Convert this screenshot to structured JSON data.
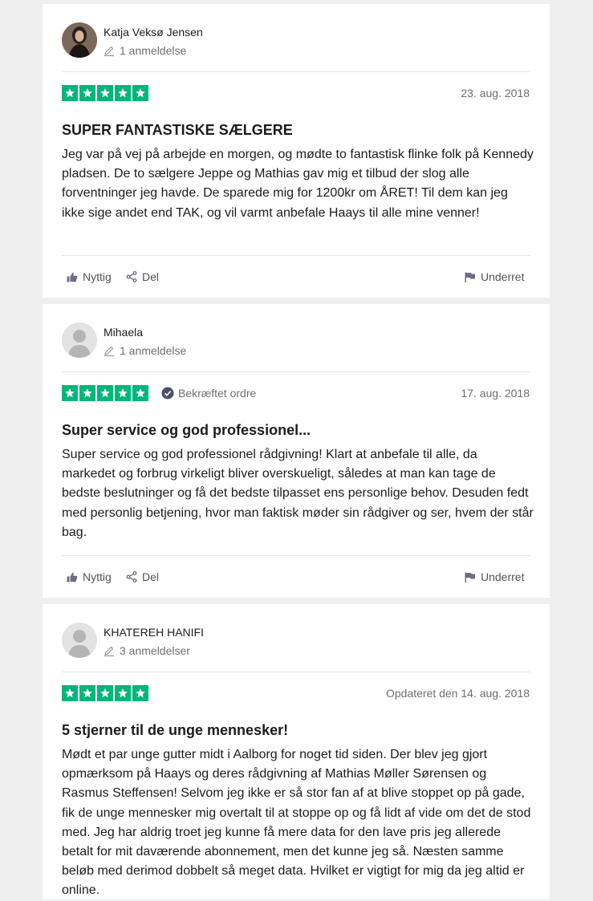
{
  "colors": {
    "star_green": "#00b67a",
    "page_bg": "#efefef",
    "muted": "#6f6f6f"
  },
  "actions": {
    "helpful": "Nyttig",
    "share": "Del",
    "report": "Underret"
  },
  "reviews": [
    {
      "reviewer": "Katja Veksø Jensen",
      "review_count": "1 anmeldelse",
      "avatar": "photo",
      "rating": 5,
      "verified": "",
      "date": "23. aug. 2018",
      "title": "SUPER FANTASTISKE SÆLGERE",
      "body": "Jeg var på vej på arbejde en morgen, og mødte to fantastisk flinke folk på Kennedy pladsen. De to sælgere Jeppe og Mathias gav mig et tilbud der slog alle forventninger jeg havde. De sparede mig for 1200kr om ÅRET! Til dem kan jeg ikke sige andet end TAK, og vil varmt anbefale Haays til alle mine venner!"
    },
    {
      "reviewer": "Mihaela",
      "review_count": "1 anmeldelse",
      "avatar": "default",
      "rating": 5,
      "verified": "Bekræftet ordre",
      "date": "17. aug. 2018",
      "title": "Super service og god professionel...",
      "body": "Super service og god professionel rådgivning! Klart at anbefale til alle, da markedet og forbrug virkeligt bliver overskueligt, således at man kan tage de bedste beslutninger og få det bedste tilpasset ens personlige behov. Desuden fedt med personlig betjening, hvor man faktisk møder sin rådgiver og ser, hvem der står bag."
    },
    {
      "reviewer": "KHATEREH HANIFI",
      "review_count": "3 anmeldelser",
      "avatar": "default",
      "rating": 5,
      "verified": "",
      "date": "Opdateret den 14. aug. 2018",
      "title": "5 stjerner til de unge mennesker!",
      "body": "Mødt et par unge gutter midt i Aalborg for noget tid siden. Der blev jeg gjort opmærksom på Haays og deres rådgivning af Mathias Møller Sørensen og Rasmus Steffensen! Selvom jeg ikke er så stor fan af at blive stoppet op på gade, fik de unge mennesker mig overtalt til at stoppe op og få lidt af vide om det de stod med. Jeg har aldrig troet jeg kunne få mere data for den lave pris jeg allerede betalt for mit daværende abonnement, men det kunne jeg så. Næsten samme beløb med derimod dobbelt så meget data. Hvilket er vigtigt for mig da jeg altid er online."
    }
  ]
}
